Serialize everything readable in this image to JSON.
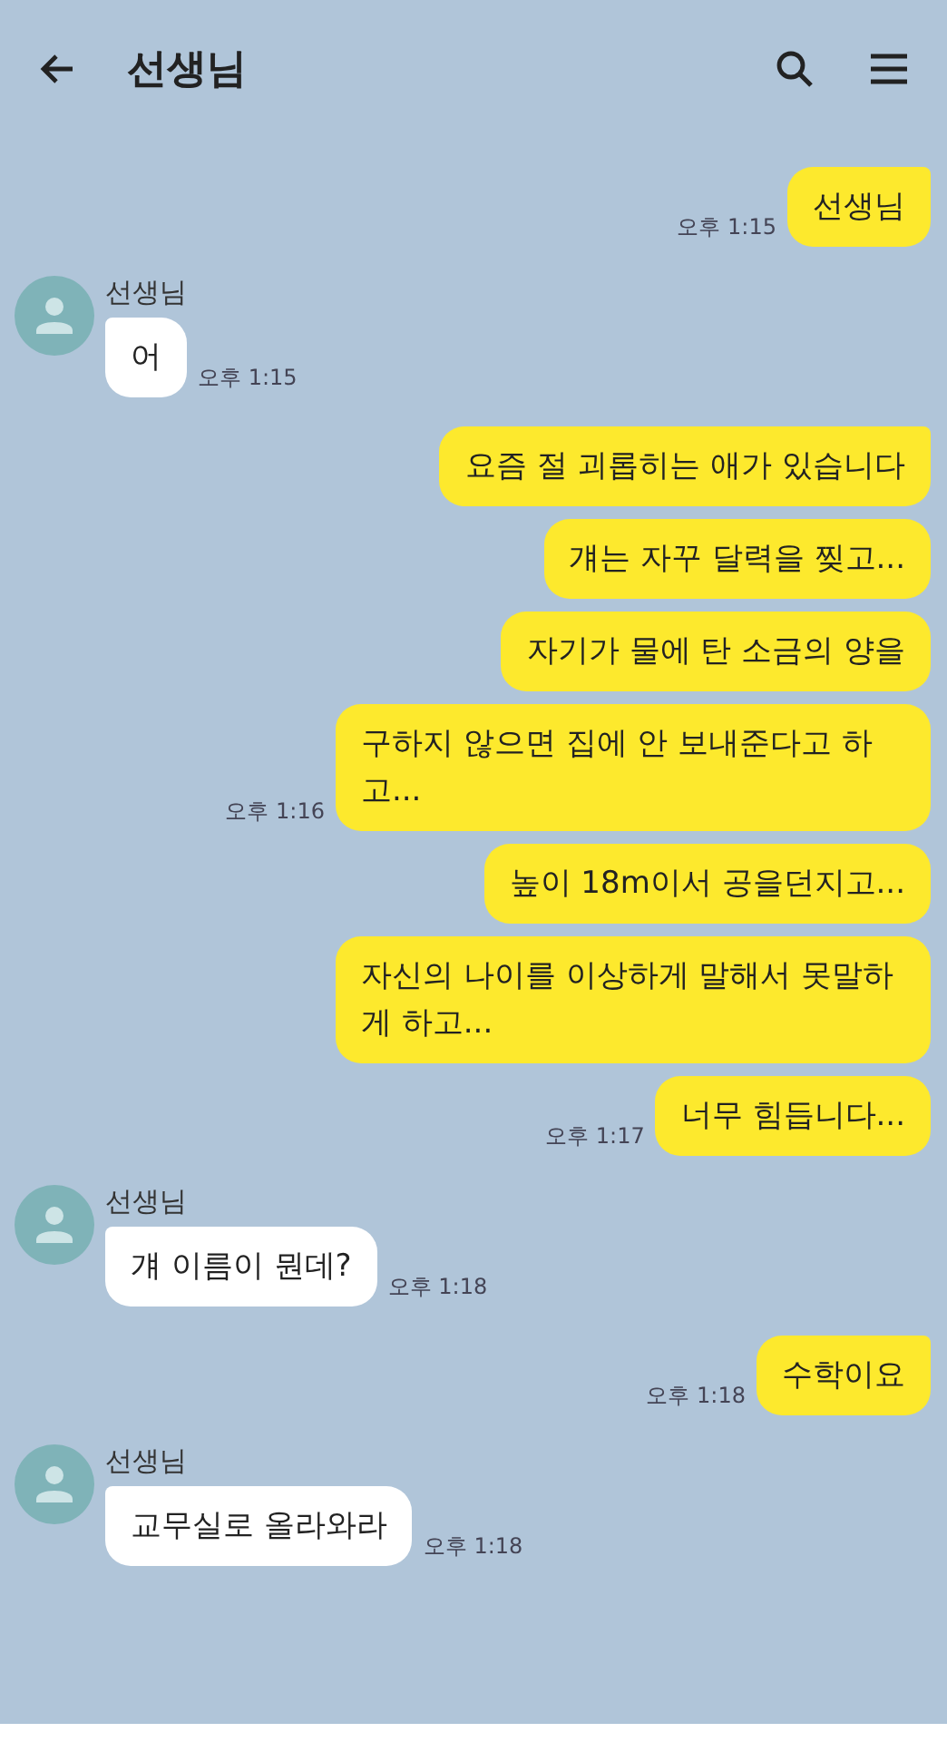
{
  "header": {
    "title": "선생님"
  },
  "messages": [
    {
      "kind": "sent",
      "text": "선생님",
      "time": "오후 1:15"
    },
    {
      "kind": "received",
      "sender": "선생님",
      "text": "어",
      "time": "오후 1:15"
    },
    {
      "kind": "sent",
      "text": "요즘 절 괴롭히는 애가 있습니다"
    },
    {
      "kind": "sent",
      "text": "걔는 자꾸 달력을 찢고..."
    },
    {
      "kind": "sent",
      "text": "자기가 물에 탄 소금의 양을"
    },
    {
      "kind": "sent",
      "text": "구하지 않으면 집에 안 보내준다고 하고...",
      "time": "오후 1:16"
    },
    {
      "kind": "sent",
      "text": "높이 18m이서 공을던지고..."
    },
    {
      "kind": "sent",
      "text": "자신의 나이를 이상하게 말해서 못말하게 하고..."
    },
    {
      "kind": "sent",
      "text": "너무 힘듭니다...",
      "time": "오후 1:17"
    },
    {
      "kind": "received",
      "sender": "선생님",
      "text": "걔 이름이 뭔데?",
      "time": "오후 1:18"
    },
    {
      "kind": "sent",
      "text": "수학이요",
      "time": "오후 1:18"
    },
    {
      "kind": "received",
      "sender": "선생님",
      "text": "교무실로 올라와라",
      "time": "오후 1:18"
    }
  ]
}
